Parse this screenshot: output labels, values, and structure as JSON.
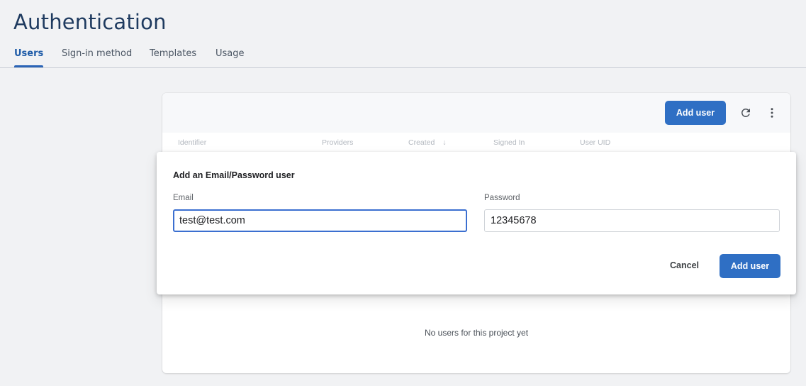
{
  "header": {
    "title": "Authentication"
  },
  "tabs": [
    {
      "label": "Users",
      "active": true
    },
    {
      "label": "Sign-in method",
      "active": false
    },
    {
      "label": "Templates",
      "active": false
    },
    {
      "label": "Usage",
      "active": false
    }
  ],
  "users_card": {
    "add_user_label": "Add user",
    "refresh_icon": "refresh-icon",
    "more_icon": "more-vert-icon",
    "columns": [
      "Identifier",
      "Providers",
      "Created",
      "Signed In",
      "User UID"
    ],
    "sort_icon": "arrow-down-icon",
    "empty_message": "No users for this project yet"
  },
  "dialog": {
    "title": "Add an Email/Password user",
    "email_label": "Email",
    "email_value": "test@test.com",
    "password_label": "Password",
    "password_value": "12345678",
    "cancel_label": "Cancel",
    "submit_label": "Add user"
  },
  "colors": {
    "accent": "#2f6fc4",
    "title": "#1e3a5f",
    "background": "#f1f2f4"
  }
}
